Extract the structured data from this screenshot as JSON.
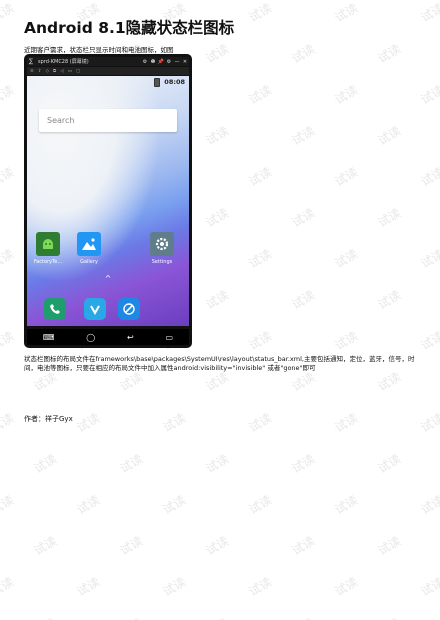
{
  "document": {
    "title": "Android 8.1隐藏状态栏图标",
    "intro": "近期客户需求，状态栏只显示时间和电池图标，如图",
    "paragraph": "状态栏图标的布局文件在frameworks\\base\\packages\\SystemUI\\res\\layout\\status_bar.xml,主要包括通知，定位，蓝牙，信号，时间，电池等图标，只要在相应的布局文件中加入属性android:visibility=\"invisible\" 或者\"gone\"即可",
    "author": "作者：祥子Gyx",
    "watermark": "试读"
  },
  "screenshot": {
    "window_title": "sprd-KMC28 (屏幕镜)",
    "window_buttons": [
      "⚙",
      "❶",
      "📌",
      "⚙",
      "—",
      "✕"
    ],
    "toolbar_icons": [
      "≡",
      "⇪",
      "◇",
      "⧉",
      "◁",
      "▭",
      "▢"
    ],
    "status_time": "08:08",
    "search_placeholder": "Search",
    "apps": [
      {
        "label": "FactoryTe...",
        "icon": "android-icon",
        "color": "#2e7d32"
      },
      {
        "label": "Gallery",
        "icon": "gallery-icon",
        "color": "#2196f3"
      },
      {
        "label": "Settings",
        "icon": "gear-icon",
        "color": "#607d8b"
      }
    ],
    "dock": [
      {
        "icon": "phone-icon",
        "color": "#1e9e6a",
        "glyph": "✆"
      },
      {
        "icon": "messages-icon",
        "color": "#29a8e8",
        "glyph": "V"
      },
      {
        "icon": "browser-icon",
        "color": "#1e88e5",
        "glyph": "⊘"
      }
    ],
    "nav_buttons": [
      "⌨",
      "◯",
      "↩",
      "▭"
    ],
    "chevron": "^"
  }
}
